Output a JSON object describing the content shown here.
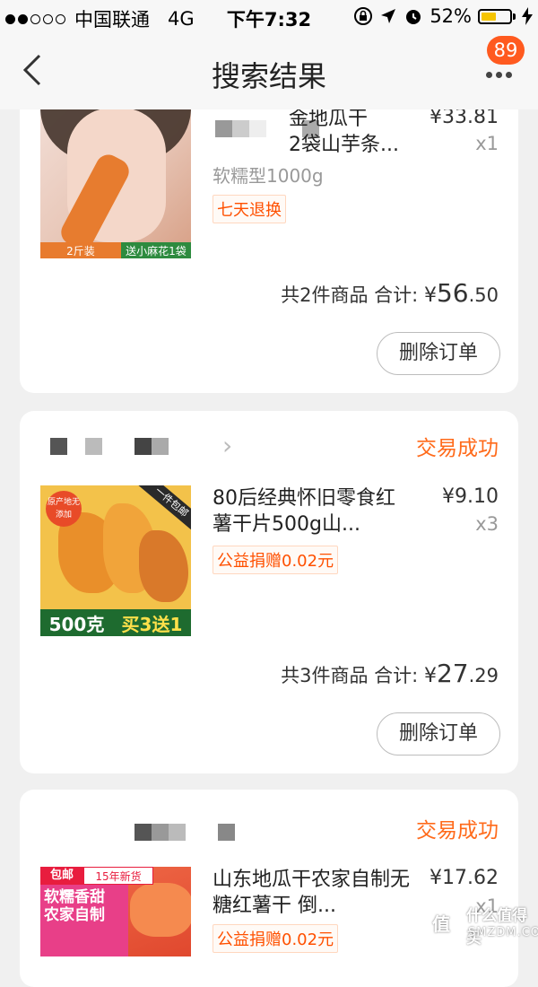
{
  "status_bar": {
    "carrier": "中国联通",
    "network": "4G",
    "time": "下午7:32",
    "battery_pct": "52%",
    "battery_level": 0.52,
    "battery_color": "#f5c400"
  },
  "nav": {
    "title": "搜索结果",
    "badge": "89",
    "back_icon": "chevron-left-icon",
    "more_icon": "more-dots-icon"
  },
  "orders": [
    {
      "shop_name": "",
      "status": "",
      "item": {
        "title": "金地瓜干\n2袋山芋条...",
        "sku": "软糯型1000g",
        "tag": "七天退换",
        "price": "¥33.81",
        "qty": "x1",
        "thumb_caption_left": "2斤装",
        "thumb_caption_right": "送小麻花1袋"
      },
      "summary": {
        "prefix": "共2件商品 合计:",
        "currency": "¥",
        "integer": "56",
        "decimal": ".50"
      },
      "delete_label": "删除订单"
    },
    {
      "shop_name": "",
      "status": "交易成功",
      "item": {
        "title": "80后经典怀旧零食红薯干片500g山...",
        "sku": "",
        "tag": "公益捐赠0.02元",
        "price": "¥9.10",
        "qty": "x3",
        "thumb_stamp": "原产地无添加",
        "thumb_ribbon": "一件包邮",
        "thumb_weight": "500克",
        "thumb_promo": "买3送1"
      },
      "summary": {
        "prefix": "共3件商品 合计:",
        "currency": "¥",
        "integer": "27",
        "decimal": ".29"
      },
      "delete_label": "删除订单"
    },
    {
      "shop_name": "",
      "status": "交易成功",
      "item": {
        "title": "山东地瓜干农家自制无糖红薯干 倒...",
        "sku": "",
        "tag": "公益捐赠0.02元",
        "price": "¥17.62",
        "qty": "x1",
        "thumb_top_left": "包邮",
        "thumb_top_right": "15年新货",
        "thumb_pink_1": "软糯香甜",
        "thumb_pink_2": "农家自制"
      }
    }
  ],
  "watermark": {
    "icon_text": "值",
    "text": "什么值得买",
    "sub": "SMZDM.COM"
  },
  "colors": {
    "accent": "#ff6a1a",
    "badge": "#ff5a1f",
    "tag": "#ff5000"
  }
}
